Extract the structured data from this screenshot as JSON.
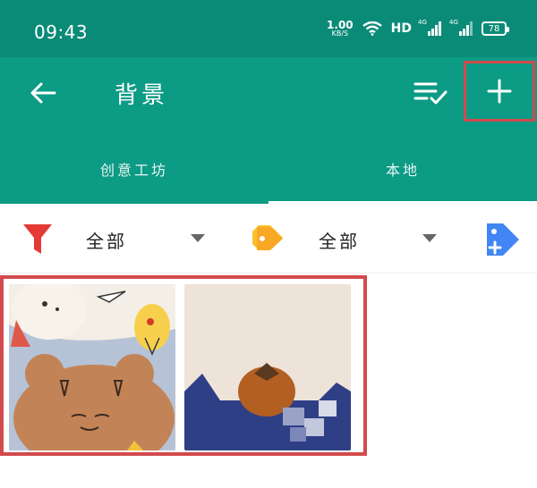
{
  "status_bar": {
    "time": "09:43",
    "net_speed_value": "1.00",
    "net_speed_unit": "KB/S",
    "hd_label": "HD",
    "signal_1_label": "4G",
    "signal_2_label": "4G",
    "battery_level": "78"
  },
  "app_bar": {
    "title": "背景",
    "back_icon": "arrow-left-icon",
    "list_icon": "list-check-icon",
    "add_icon": "plus-icon"
  },
  "tabs": [
    {
      "label": "创意工坊",
      "selected": false
    },
    {
      "label": "本地",
      "selected": true
    }
  ],
  "filters": {
    "category_label": "全部",
    "category_icon": "filter-funnel-icon",
    "tag_label": "全部",
    "tag_icon": "tag-icon",
    "add_tag_icon": "add-tag-icon"
  },
  "gallery": {
    "items": [
      {
        "name": "wallpaper-illustration-bear"
      },
      {
        "name": "wallpaper-illustration-persimmon"
      }
    ]
  },
  "colors": {
    "status_bar": "#0a8b78",
    "app_bar": "#0c9b85",
    "highlight_border": "#d24a4d",
    "filter_red": "#e53935",
    "tag_orange": "#f9a825",
    "add_tag_blue": "#4285f4"
  }
}
